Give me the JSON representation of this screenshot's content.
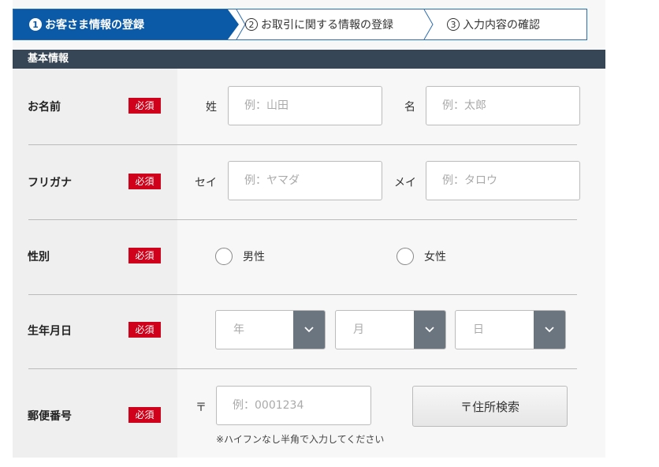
{
  "steps": [
    {
      "num": "1",
      "label": "お客さま情報の登録"
    },
    {
      "num": "2",
      "label": "お取引に関する情報の登録"
    },
    {
      "num": "3",
      "label": "入力内容の確認"
    }
  ],
  "section": {
    "title": "基本情報"
  },
  "required_label": "必須",
  "name": {
    "label": "お名前",
    "last_prefix": "姓",
    "last_placeholder": "例：山田",
    "first_prefix": "名",
    "first_placeholder": "例：太郎"
  },
  "kana": {
    "label": "フリガナ",
    "last_prefix": "セイ",
    "last_placeholder": "例：ヤマダ",
    "first_prefix": "メイ",
    "first_placeholder": "例：タロウ"
  },
  "gender": {
    "label": "性別",
    "options": [
      "男性",
      "女性"
    ]
  },
  "birthday": {
    "label": "生年月日",
    "year": "年",
    "month": "月",
    "day": "日"
  },
  "postal": {
    "label": "郵便番号",
    "prefix": "〒",
    "placeholder": "例：0001234",
    "search_button": "〒住所検索",
    "note": "※ハイフンなし半角で入力してください"
  },
  "colors": {
    "accent": "#0a5aa8",
    "header": "#374656",
    "required": "#d0021b"
  }
}
